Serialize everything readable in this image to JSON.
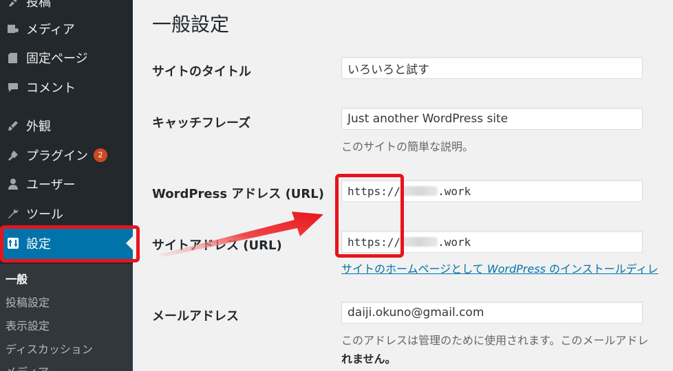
{
  "sidebar": {
    "items": [
      {
        "label": "投稿",
        "icon": "pin-icon"
      },
      {
        "label": "メディア",
        "icon": "media-icon"
      },
      {
        "label": "固定ページ",
        "icon": "page-icon"
      },
      {
        "label": "コメント",
        "icon": "comment-icon"
      },
      {
        "label": "外観",
        "icon": "brush-icon"
      },
      {
        "label": "プラグイン",
        "icon": "plugin-icon",
        "badge": "2"
      },
      {
        "label": "ユーザー",
        "icon": "user-icon"
      },
      {
        "label": "ツール",
        "icon": "wrench-icon"
      },
      {
        "label": "設定",
        "icon": "settings-icon",
        "active": true
      }
    ],
    "submenu": [
      "一般",
      "投稿設定",
      "表示設定",
      "ディスカッション",
      "メディア"
    ]
  },
  "main": {
    "title": "一般設定",
    "fields": {
      "site_title": {
        "label": "サイトのタイトル",
        "value": "いろいろと試す"
      },
      "tagline": {
        "label": "キャッチフレーズ",
        "value": "Just another WordPress site",
        "description": "このサイトの簡単な説明。"
      },
      "wp_url": {
        "label": "WordPress アドレス (URL)",
        "prefix": "https://",
        "suffix": ".work"
      },
      "site_url": {
        "label": "サイトアドレス (URL)",
        "prefix": "https://",
        "suffix": ".work",
        "description_a": "サイトのホームページとして ",
        "description_b": "WordPress",
        "description_c": " のインストールディレ"
      },
      "email": {
        "label": "メールアドレス",
        "value": "daiji.okuno@gmail.com",
        "description": "このアドレスは管理のために使用されます。このメールアドレ",
        "description_strong": "れません。"
      }
    }
  },
  "colors": {
    "accent": "#0073aa",
    "highlight": "#e8141c",
    "sidebar": "#23282d"
  }
}
